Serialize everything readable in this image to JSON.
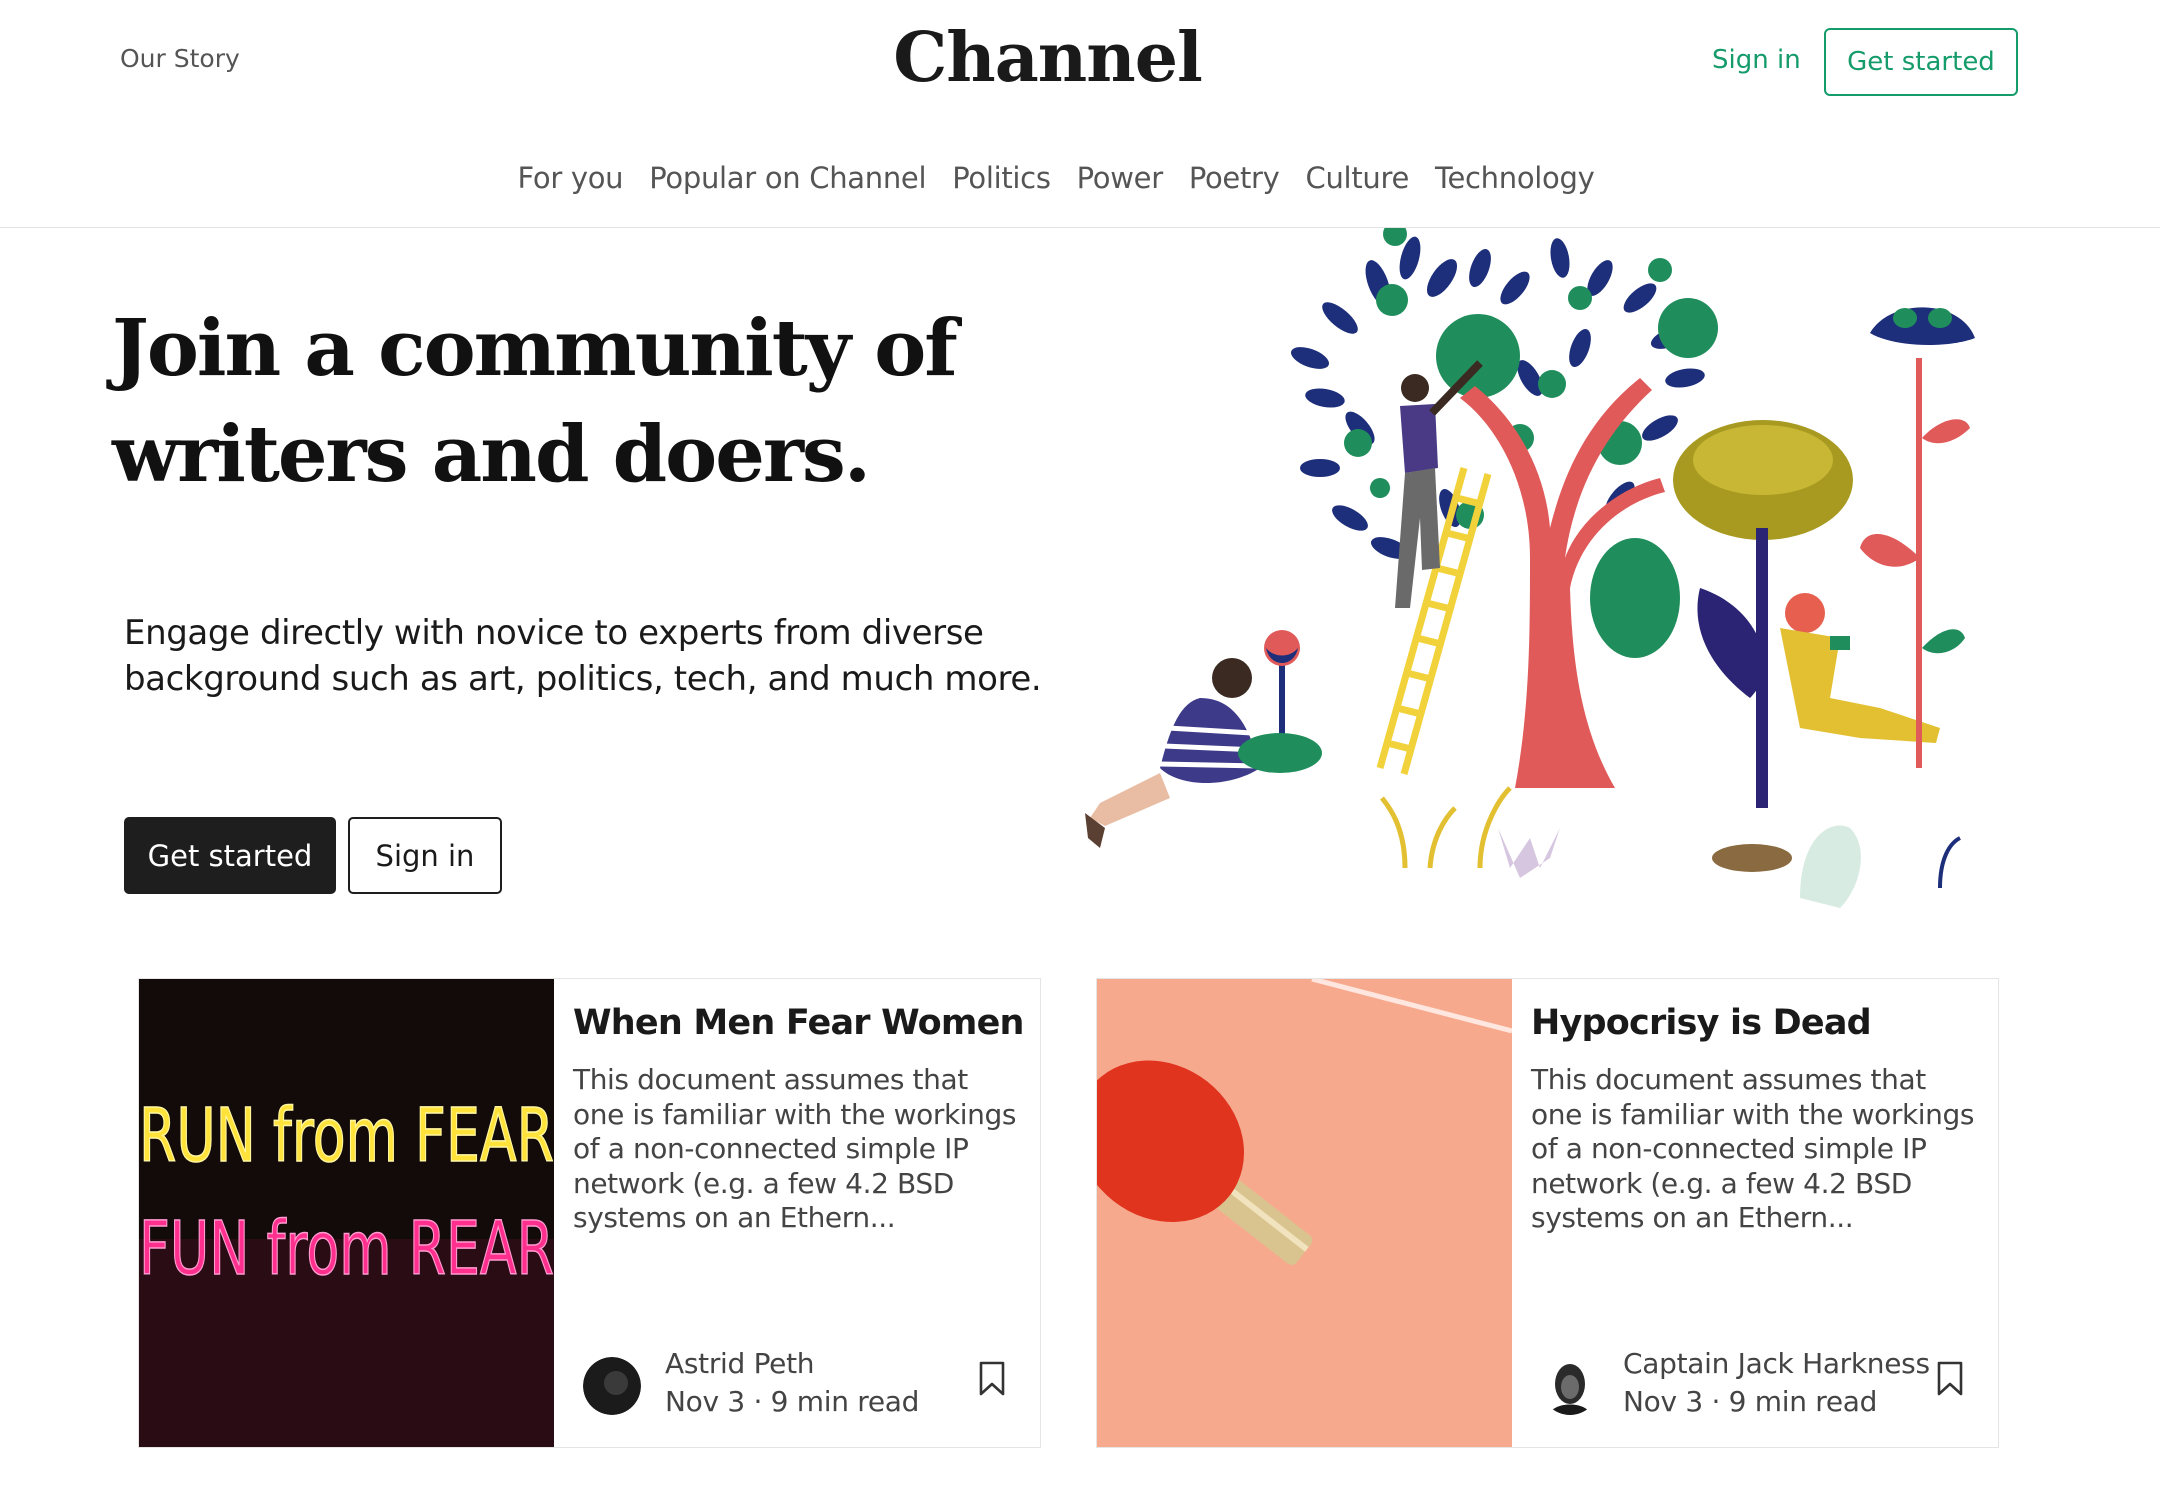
{
  "header": {
    "our_story": "Our Story",
    "logo": "Channel",
    "sign_in": "Sign in",
    "get_started": "Get started"
  },
  "nav": {
    "items": [
      "For you",
      "Popular on Channel",
      "Politics",
      "Power",
      "Poetry",
      "Culture",
      "Technology"
    ]
  },
  "hero": {
    "title_line1": "Join a community of",
    "title_line2": "writers and doers.",
    "subtitle_line1": "Engage directly with novice to experts from diverse",
    "subtitle_line2": "background such as art, politics, tech, and much more.",
    "cta_primary": "Get started",
    "cta_secondary": "Sign in"
  },
  "cards": [
    {
      "title": "When Men Fear Women",
      "excerpt": "This document assumes that one is familiar with the workings of a non-connected simple IP network (e.g. a few 4.2 BSD systems on an Ethern...",
      "author": "Astrid Peth",
      "meta": "Nov 3 · 9 min read",
      "image_text_top": "RUN from FEAR",
      "image_text_bottom": "FUN from REAR"
    },
    {
      "title": "Hypocrisy is Dead",
      "excerpt": "This document assumes that one is familiar with the workings of a non-connected simple IP network (e.g. a few 4.2 BSD systems on an Ethern...",
      "author": "Captain Jack Harkness",
      "meta": "Nov 3 · 9 min read"
    }
  ],
  "colors": {
    "accent": "#169b6b",
    "dark_button": "#1e1e1e",
    "card_border": "#e5e5e5",
    "text_muted": "#444444"
  },
  "icons": [
    "bookmark-icon",
    "avatar"
  ]
}
